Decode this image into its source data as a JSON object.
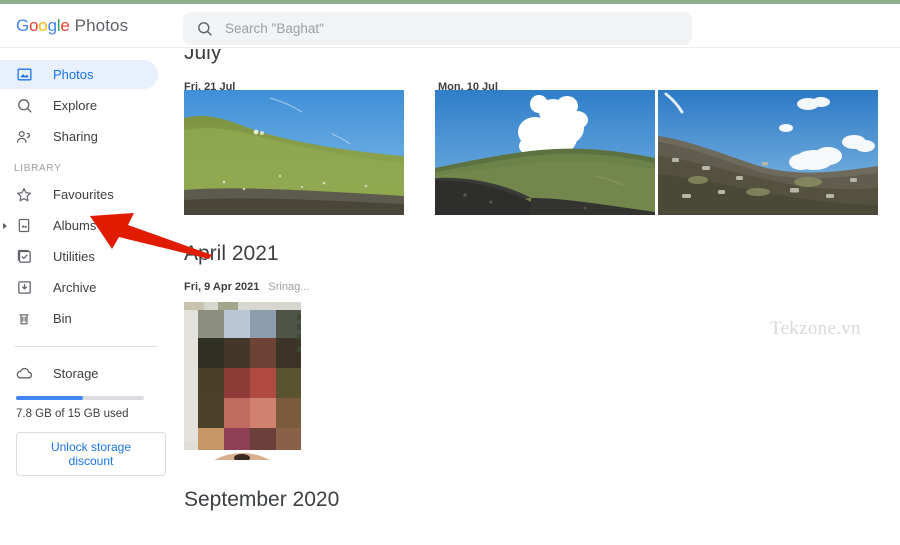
{
  "app": {
    "brand_google": "Google",
    "brand_product": "Photos",
    "watermark": "Tekzone.vn"
  },
  "search": {
    "placeholder": "Search \"Baghat\"",
    "value": "",
    "icon": "search-icon"
  },
  "sidebar": {
    "primary": [
      {
        "label": "Photos",
        "icon": "photo-icon",
        "active": true
      },
      {
        "label": "Explore",
        "icon": "search-icon",
        "active": false
      },
      {
        "label": "Sharing",
        "icon": "people-icon",
        "active": false
      }
    ],
    "section_label": "LIBRARY",
    "library": [
      {
        "label": "Favourites",
        "icon": "star-icon",
        "expandable": false
      },
      {
        "label": "Albums",
        "icon": "albums-icon",
        "expandable": true
      },
      {
        "label": "Utilities",
        "icon": "utilities-icon",
        "expandable": false
      },
      {
        "label": "Archive",
        "icon": "archive-icon",
        "expandable": false
      },
      {
        "label": "Bin",
        "icon": "trash-icon",
        "expandable": false
      }
    ],
    "storage": {
      "label": "Storage",
      "icon": "cloud-icon",
      "used_text": "7.8 GB of 15 GB used",
      "percent": 52,
      "fill_color": "#4285F4",
      "track_color": "#dadce0",
      "button_label": "Unlock storage discount"
    }
  },
  "main": {
    "sections": [
      {
        "heading": "July",
        "groups": [
          {
            "date": "Fri, 21 Jul",
            "place": ""
          },
          {
            "date": "Mon, 10 Jul",
            "place": ""
          }
        ]
      },
      {
        "heading": "April 2021",
        "groups": [
          {
            "date": "Fri, 9 Apr 2021",
            "place": "Srinag..."
          }
        ]
      },
      {
        "heading": "September 2020",
        "groups": []
      }
    ]
  },
  "annotation": {
    "type": "arrow",
    "color": "#e01b00",
    "points_to": "Albums"
  },
  "colors": {
    "accent_blue": "#1a73e8",
    "active_pill": "#e8f0fe",
    "search_bg": "#f1f3f4",
    "top_strip": "#8bb08b",
    "text_primary": "#3c4043",
    "text_muted": "#9aa0a6"
  }
}
